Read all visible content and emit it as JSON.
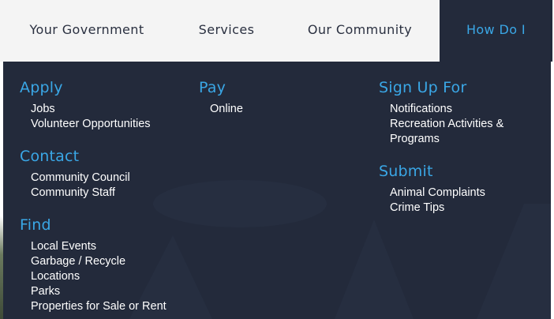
{
  "topnav": {
    "items": [
      {
        "label": "Your Government"
      },
      {
        "label": "Services"
      },
      {
        "label": "Our Community"
      },
      {
        "label": "How Do I"
      }
    ]
  },
  "dropdown": {
    "columns": [
      {
        "sections": [
          {
            "title": "Apply",
            "links": [
              "Jobs",
              "Volunteer Opportunities"
            ]
          },
          {
            "title": "Contact",
            "links": [
              "Community Council",
              "Community Staff"
            ]
          },
          {
            "title": "Find",
            "links": [
              "Local Events",
              "Garbage / Recycle",
              "Locations",
              "Parks",
              "Properties for Sale or Rent"
            ]
          }
        ]
      },
      {
        "sections": [
          {
            "title": "Pay",
            "links": [
              "Online"
            ]
          }
        ]
      },
      {
        "sections": [
          {
            "title": "Sign Up For",
            "links": [
              "Notifications",
              "Recreation Activities & Programs"
            ]
          },
          {
            "title": "Submit",
            "links": [
              "Animal Complaints",
              "Crime Tips"
            ]
          }
        ]
      }
    ]
  },
  "colors": {
    "panel": "#232a3b",
    "accent": "#3aa7e6",
    "nav_bg": "#f4f4f4",
    "nav_text": "#2a3040"
  }
}
